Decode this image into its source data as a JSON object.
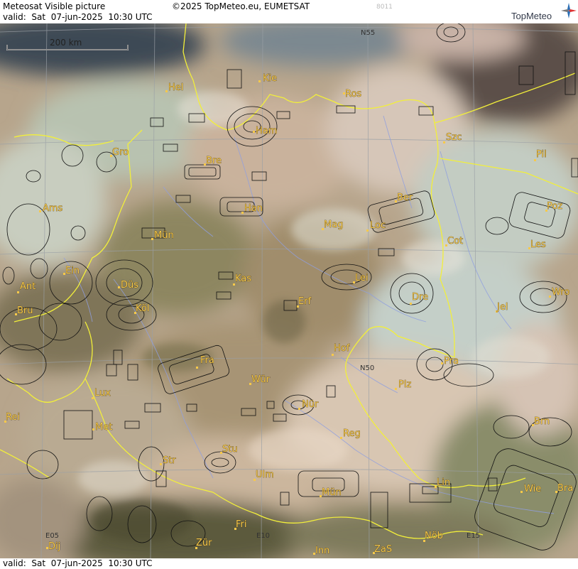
{
  "header": {
    "title": "Meteosat Visible picture",
    "copyright": "©2025 TopMeteo.eu, EUMETSAT",
    "valid": "valid:  Sat  07-jun-2025  10:30 UTC",
    "stamp": "8011",
    "brand": "TopMeteo"
  },
  "footer": {
    "valid": "valid:  Sat  07-jun-2025  10:30 UTC"
  },
  "scale_bar": {
    "label": "200 km"
  },
  "grid_labels": {
    "n55": "N55",
    "n50": "N50",
    "e05": "E05",
    "e10": "E10",
    "e15": "E15"
  },
  "cities": {
    "kie": "Kie",
    "hel": "Hel",
    "ros": "Ros",
    "ham": "Ham",
    "szc": "Szc",
    "gro": "Gro",
    "bre": "Bre",
    "pil": "Pil",
    "ber": "Ber",
    "ams": "Ams",
    "han": "Han",
    "mag": "Mag",
    "loc": "Loc",
    "poz": "Poz",
    "mun": "Mün",
    "cot": "Cot",
    "les": "Les",
    "ein": "Ein",
    "kas": "Kas",
    "lei": "Lei",
    "ant": "Ant",
    "dus": "Düs",
    "dre": "Dre",
    "wro": "Wro",
    "bru": "Bru",
    "kol": "Köl",
    "erf": "Erf",
    "jel": "Jel",
    "hof": "Hof",
    "fra": "Fra",
    "pra": "Pra",
    "wur": "Wür",
    "plz": "Plz",
    "lux": "Lux",
    "nur": "Nür",
    "rei": "Rei",
    "met": "Met",
    "reg": "Reg",
    "brn": "Brn",
    "stu": "Stu",
    "str": "Str",
    "ulm": "Ulm",
    "lin": "Lin",
    "wie": "Wie",
    "bra": "Bra",
    "mun2": "Mün",
    "fri": "Fri",
    "dij": "Dij",
    "zur": "Zür",
    "nob": "Nöb",
    "inn": "Inn",
    "zas": "ZaS"
  }
}
